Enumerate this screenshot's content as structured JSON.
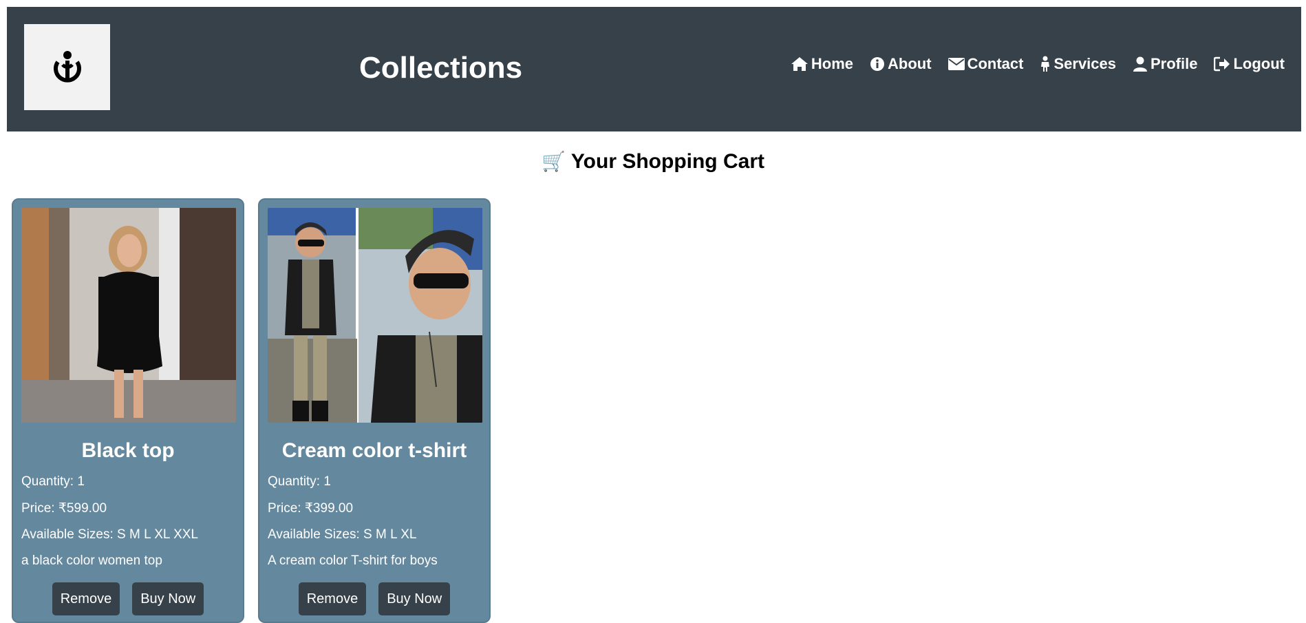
{
  "header": {
    "title": "Collections",
    "logo_icon": "wikimedia-logo",
    "background": "#36414a",
    "nav": [
      {
        "label": "Home",
        "icon": "home-icon"
      },
      {
        "label": "About",
        "icon": "info-icon"
      },
      {
        "label": "Contact",
        "icon": "envelope-icon"
      },
      {
        "label": "Services",
        "icon": "child-icon"
      },
      {
        "label": "Profile",
        "icon": "user-icon"
      },
      {
        "label": "Logout",
        "icon": "sign-out-icon"
      }
    ]
  },
  "cart": {
    "icon": "🛒",
    "heading": "Your Shopping Cart",
    "items": [
      {
        "name": "Black top",
        "quantity": "Quantity: 1",
        "price": "Price: ₹599.00",
        "sizes": "Available Sizes: S M L XL XXL",
        "description": "a black color women top",
        "remove_label": "Remove",
        "buy_label": "Buy Now"
      },
      {
        "name": "Cream color t-shirt",
        "quantity": "Quantity: 1",
        "price": "Price: ₹399.00",
        "sizes": "Available Sizes: S M L XL",
        "description": "A cream color T-shirt for boys",
        "remove_label": "Remove",
        "buy_label": "Buy Now"
      }
    ]
  },
  "colors": {
    "header_bg": "#36414a",
    "card_bg": "#64889e",
    "button_bg": "#36414a"
  }
}
